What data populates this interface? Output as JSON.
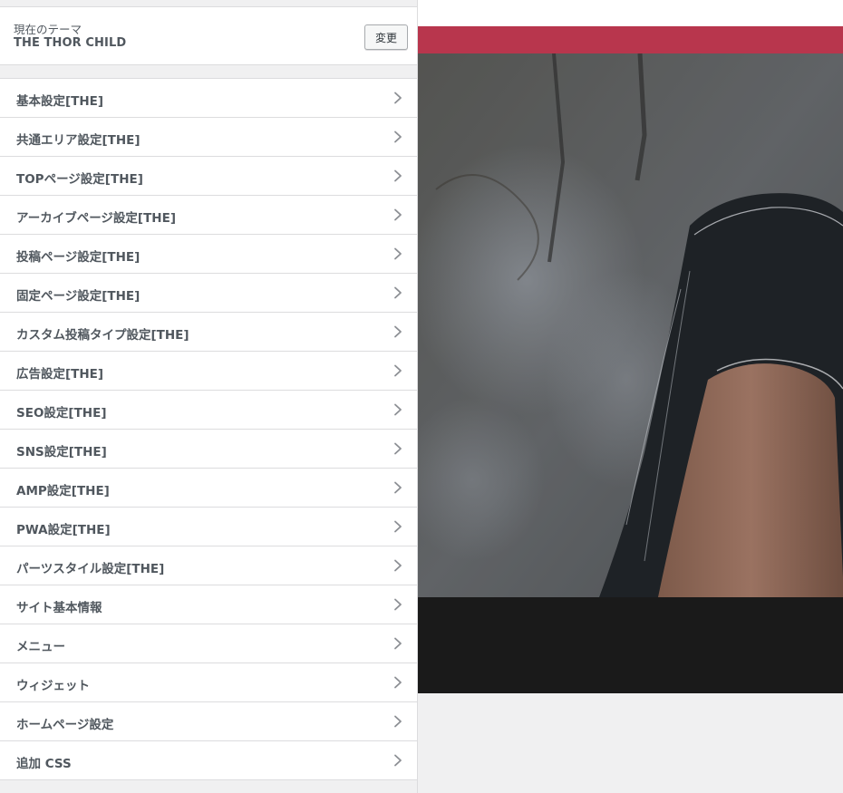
{
  "theme": {
    "current_label": "現在のテーマ",
    "name": "THE THOR CHILD",
    "change_label": "変更"
  },
  "panels": [
    {
      "label": "基本設定[THE]"
    },
    {
      "label": "共通エリア設定[THE]"
    },
    {
      "label": "TOPページ設定[THE]"
    },
    {
      "label": "アーカイブページ設定[THE]"
    },
    {
      "label": "投稿ページ設定[THE]"
    },
    {
      "label": "固定ページ設定[THE]"
    },
    {
      "label": "カスタム投稿タイプ設定[THE]"
    },
    {
      "label": "広告設定[THE]"
    },
    {
      "label": "SEO設定[THE]"
    },
    {
      "label": "SNS設定[THE]"
    },
    {
      "label": "AMP設定[THE]"
    },
    {
      "label": "PWA設定[THE]"
    },
    {
      "label": "パーツスタイル設定[THE]"
    },
    {
      "label": "サイト基本情報"
    },
    {
      "label": "メニュー"
    },
    {
      "label": "ウィジェット"
    },
    {
      "label": "ホームページ設定"
    },
    {
      "label": "追加 CSS"
    }
  ],
  "icons": {
    "panel_arrow": "chevron-right-icon"
  },
  "colors": {
    "accent_bar": "#b8364d",
    "footer": "#1a1a1a",
    "text": "#50575e"
  }
}
